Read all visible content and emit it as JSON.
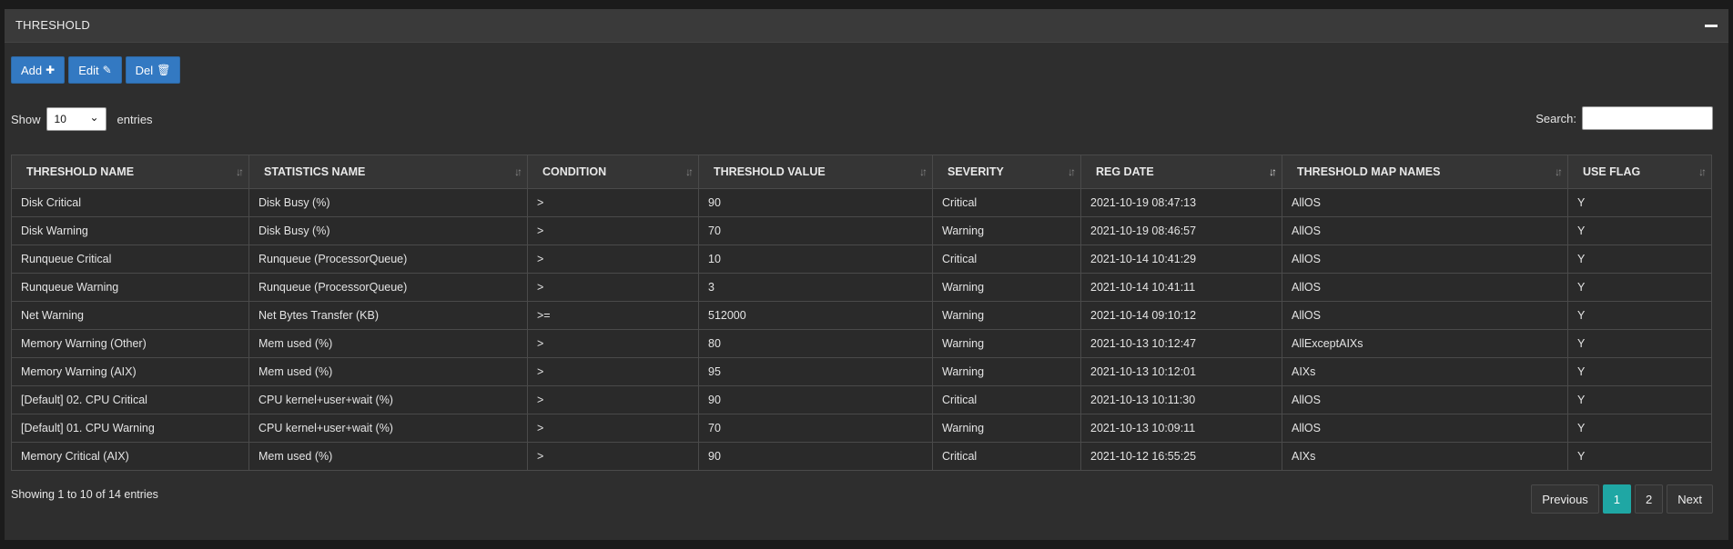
{
  "panel": {
    "title": "THRESHOLD"
  },
  "toolbar": {
    "add_label": "Add",
    "edit_label": "Edit",
    "del_label": "Del"
  },
  "length": {
    "show_label": "Show",
    "value": "10",
    "entries_label": "entries"
  },
  "search": {
    "label": "Search:",
    "value": ""
  },
  "table": {
    "columns": [
      "THRESHOLD NAME",
      "STATISTICS NAME",
      "CONDITION",
      "THRESHOLD VALUE",
      "SEVERITY",
      "REG DATE",
      "THRESHOLD MAP NAMES",
      "USE FLAG"
    ],
    "rows": [
      [
        "Disk Critical",
        "Disk Busy (%)",
        ">",
        "90",
        "Critical",
        "2021-10-19 08:47:13",
        "AllOS",
        "Y"
      ],
      [
        "Disk Warning",
        "Disk Busy (%)",
        ">",
        "70",
        "Warning",
        "2021-10-19 08:46:57",
        "AllOS",
        "Y"
      ],
      [
        "Runqueue Critical",
        "Runqueue (ProcessorQueue)",
        ">",
        "10",
        "Critical",
        "2021-10-14 10:41:29",
        "AllOS",
        "Y"
      ],
      [
        "Runqueue Warning",
        "Runqueue (ProcessorQueue)",
        ">",
        "3",
        "Warning",
        "2021-10-14 10:41:11",
        "AllOS",
        "Y"
      ],
      [
        "Net Warning",
        "Net Bytes Transfer (KB)",
        ">=",
        "512000",
        "Warning",
        "2021-10-14 09:10:12",
        "AllOS",
        "Y"
      ],
      [
        "Memory Warning (Other)",
        "Mem used (%)",
        ">",
        "80",
        "Warning",
        "2021-10-13 10:12:47",
        "AllExceptAIXs",
        "Y"
      ],
      [
        "Memory Warning (AIX)",
        "Mem used (%)",
        ">",
        "95",
        "Warning",
        "2021-10-13 10:12:01",
        "AIXs",
        "Y"
      ],
      [
        "[Default] 02. CPU Critical",
        "CPU kernel+user+wait (%)",
        ">",
        "90",
        "Critical",
        "2021-10-13 10:11:30",
        "AllOS",
        "Y"
      ],
      [
        "[Default] 01. CPU Warning",
        "CPU kernel+user+wait (%)",
        ">",
        "70",
        "Warning",
        "2021-10-13 10:09:11",
        "AllOS",
        "Y"
      ],
      [
        "Memory Critical (AIX)",
        "Mem used (%)",
        ">",
        "90",
        "Critical",
        "2021-10-12 16:55:25",
        "AIXs",
        "Y"
      ]
    ]
  },
  "info": "Showing 1 to 10 of 14 entries",
  "pagination": {
    "previous": "Previous",
    "pages": [
      "1",
      "2"
    ],
    "next": "Next"
  },
  "colors": {
    "accent": "#3379c2",
    "active_page": "#1fa7a4"
  },
  "icons": {
    "add": "plus-icon",
    "edit": "edit-icon",
    "del": "trash-icon",
    "collapse": "minus-icon",
    "sort": "sort-icon"
  }
}
